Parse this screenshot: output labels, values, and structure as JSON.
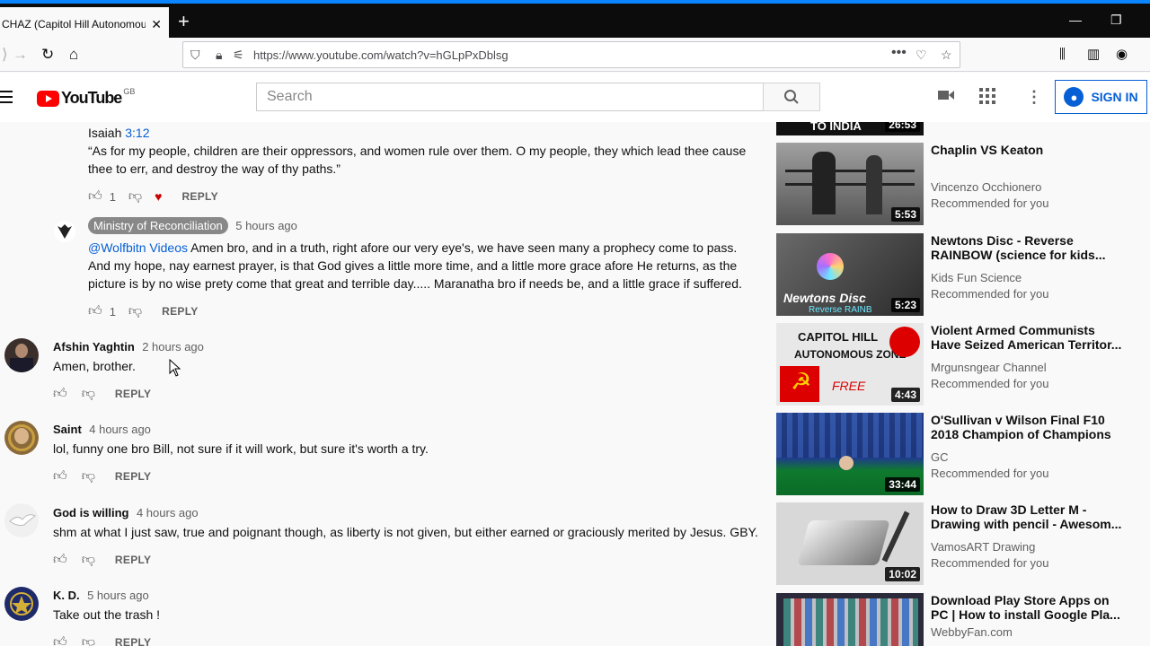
{
  "browser": {
    "tab_title": "CHAZ (Capitol Hill Autonomou",
    "tab_close": "✕",
    "new_tab": "+",
    "url": "https://www.youtube.com/watch?v=hGLpPxDblsg"
  },
  "youtube": {
    "logo_text": "YouTube",
    "logo_region": "GB",
    "search_placeholder": "Search",
    "sign_in": "SIGN IN"
  },
  "comments": [
    {
      "type": "reply",
      "verse_ref_prefix": "Isaiah ",
      "verse_ref_link": "3:12",
      "text": "“As for my people, children are their oppressors, and women rule over them. O my people, they which lead thee cause thee to err, and destroy the way of thy paths.”",
      "likes": "1",
      "reply_label": "REPLY"
    },
    {
      "type": "reply",
      "author": "Ministry of Reconciliation",
      "time": "5 hours ago",
      "mention": "@Wolfbitn Videos",
      "text": " Amen bro, and in a truth, right afore our very eye's, we have seen many a prophecy come to pass. And my hope, nay earnest prayer, is that God gives a little more time, and a little more grace afore He returns, as the picture is by no wise prety come that great and terrible day..... Maranatha bro if needs be, and a little grace if suffered.",
      "likes": "1",
      "reply_label": "REPLY"
    },
    {
      "author": "Afshin Yaghtin",
      "time": "2 hours ago",
      "text": "Amen, brother.",
      "reply_label": "REPLY",
      "avatar_color": "#3a2f2a"
    },
    {
      "author": "Saint",
      "time": "4 hours ago",
      "text": "lol, funny one bro Bill, not sure if it will work, but sure it's worth a try.",
      "reply_label": "REPLY",
      "avatar_color": "#8a6a3a"
    },
    {
      "author": "God is willing",
      "time": "4 hours ago",
      "text": "shm at what I just saw, true and poignant though, as liberty is not given, but either earned or graciously merited by Jesus. GBY.",
      "reply_label": "REPLY",
      "avatar_color": "#e8e8e8"
    },
    {
      "author": "K. D.",
      "time": "5 hours ago",
      "text": "Take out the trash !",
      "reply_label": "REPLY",
      "avatar_color": "#1e2a6a"
    }
  ],
  "sidebar": {
    "top_partial": {
      "caption": "TO INDIA",
      "duration": "26:53"
    },
    "videos": [
      {
        "title": "Chaplin VS Keaton",
        "channel": "Vincenzo Occhionero",
        "rec": "Recommended for you",
        "duration": "5:53",
        "thumb_color": "#777777"
      },
      {
        "title": "Newtons Disc - Reverse RAINBOW (science for kids...",
        "channel": "Kids Fun Science",
        "rec": "Recommended for you",
        "duration": "5:23",
        "thumb_color": "#4a4a4a",
        "caption": "Newtons Disc",
        "caption2": "Reverse RAINB"
      },
      {
        "title": "Violent Armed Communists Have Seized American Territor...",
        "channel": "Mrgunsngear Channel",
        "rec": "Recommended for you",
        "duration": "4:43",
        "thumb_color": "#dcdcdc",
        "caption": "CAPITOL HILL",
        "caption2": "AUTONOMOUS ZONE",
        "caption3": "FREE"
      },
      {
        "title": "O'Sullivan v Wilson Final F10 2018 Champion of Champions",
        "channel": "GC",
        "rec": "Recommended for you",
        "duration": "33:44",
        "thumb_color": "#1f3d8a"
      },
      {
        "title": "How to Draw 3D Letter M - Drawing with pencil - Awesom...",
        "channel": "VamosART Drawing",
        "rec": "Recommended for you",
        "duration": "10:02",
        "thumb_color": "#cfcfcf"
      },
      {
        "title": "Download Play Store Apps on PC | How to install Google Pla...",
        "channel": "WebbyFan.com",
        "rec": "",
        "duration": "",
        "thumb_color": "#2a2a3a"
      }
    ]
  },
  "colors": {
    "accent": "#065fd4",
    "brand_red": "#ff0000",
    "heart": "#cc0000"
  }
}
